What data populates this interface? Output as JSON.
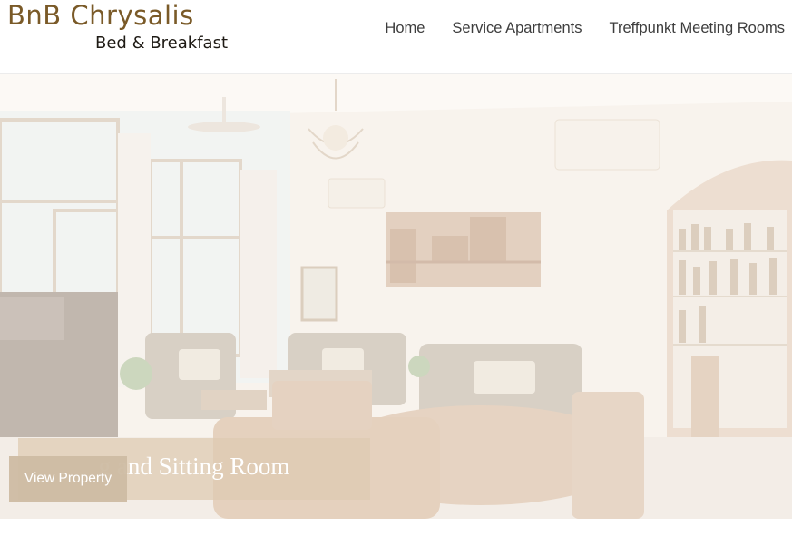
{
  "logo": {
    "title": "BnB Chrysalis",
    "subtitle": "Bed & Breakfast"
  },
  "nav": {
    "items": [
      {
        "label": "Home"
      },
      {
        "label": "Service Apartments"
      },
      {
        "label": "Treffpunkt Meeting Rooms"
      }
    ]
  },
  "hero": {
    "caption": "g and Sitting Room",
    "button_label": "View Property"
  },
  "colors": {
    "logo_title": "#7a5a28",
    "caption_box": "#decbb2",
    "button_bg": "#cdbca3"
  }
}
